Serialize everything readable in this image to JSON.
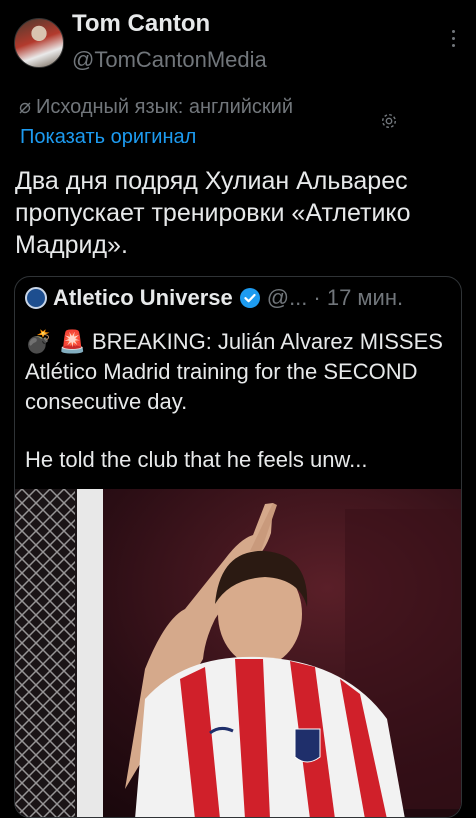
{
  "author": {
    "name": "Tom Canton",
    "handle": "@TomCantonMedia"
  },
  "translation": {
    "source_language": "Исходный язык: английский",
    "show_original": "Показать оригинал"
  },
  "tweet": {
    "text": "Два дня подряд Хулиан Альварес пропускает тренировки «Атлетико Мадрид»."
  },
  "quote": {
    "name": "Atletico Universe",
    "handle": "@...",
    "time": "· 17 мин.",
    "line1": "💣 🚨 BREAKING: Julián Alvarez MISSES Atlético Madrid training for the SECOND consecutive day.",
    "line2": "He told the club that he feels unw..."
  },
  "colors": {
    "accent": "#1d9bf0",
    "background": "#000000",
    "text": "#e7e9ea",
    "muted": "#71767b"
  }
}
